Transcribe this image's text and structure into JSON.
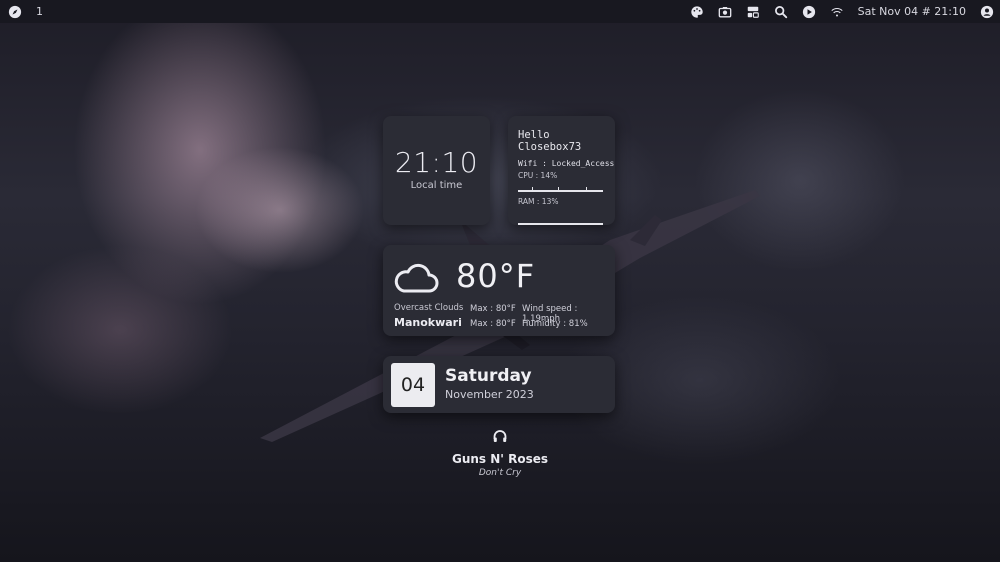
{
  "topbar": {
    "workspace": "1",
    "datetime": "Sat Nov 04 # 21:10",
    "icons": [
      "compass-icon",
      "palette-icon",
      "camera-icon",
      "layout-icon",
      "search-icon",
      "play-icon",
      "wifi-icon",
      "user-icon"
    ]
  },
  "time_widget": {
    "time": "21:10",
    "label": "Local time"
  },
  "system_widget": {
    "greeting": "Hello Closebox73",
    "wifi": "Wifi :  Locked_Access",
    "cpu": "CPU : 14%",
    "cpu_percent": 14,
    "ram": "RAM : 13%",
    "ram_percent": 13
  },
  "weather_widget": {
    "temperature": "80°F",
    "condition": "Overcast Clouds",
    "city": "Manokwari",
    "max_1": "Max : 80°F",
    "max_2": "Max : 80°F",
    "wind": "Wind speed : 1.19mph",
    "humidity": "Humidity : 81%"
  },
  "date_widget": {
    "day": "04",
    "weekday": "Saturday",
    "month_year": "November 2023"
  },
  "music_widget": {
    "artist": "Guns N' Roses",
    "title": "Don't Cry"
  },
  "colors": {
    "card_bg": "#2b2c35",
    "topbar_bg": "#181820",
    "text": "#ececf2"
  }
}
